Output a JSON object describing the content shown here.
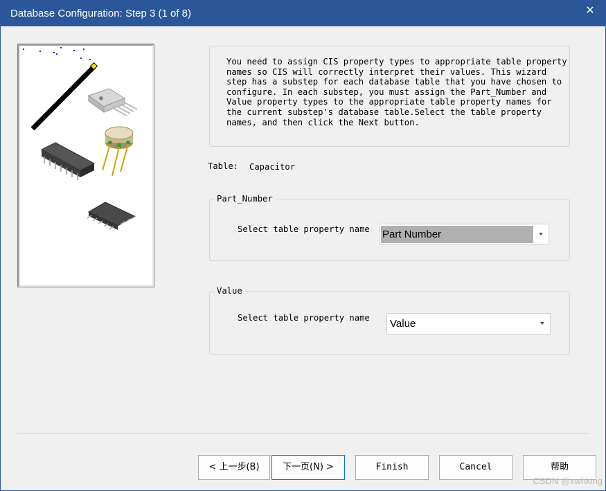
{
  "window": {
    "title": "Database Configuration: Step 3 (1 of 8)",
    "close_glyph": "✕"
  },
  "description": "You need to assign CIS property types to appropriate table property names so CIS will correctly interpret their values. This wizard step has a substep for each database table that you have chosen to configure. In each substep, you must assign the Part_Number and Value property types to the appropriate table property names for the current substep's database table.Select the table property names, and then click the Next button.",
  "table": {
    "label": "Table:",
    "value": "Capacitor"
  },
  "part_number_group": {
    "legend": "Part_Number",
    "select_label": "Select table property name",
    "selected_value": "Part Number"
  },
  "value_group": {
    "legend": "Value",
    "select_label": "Select table property name",
    "selected_value": "Value"
  },
  "buttons": {
    "back": "< 上一步(B)",
    "next": "下一页(N) >",
    "finish": "Finish",
    "cancel": "Cancel",
    "help": "帮助"
  },
  "watermark": "CSDN @xwhking",
  "colors": {
    "titlebar": "#2b579a",
    "selection_highlight": "#b0b0b0"
  },
  "icons": [
    "close-icon",
    "magic-wand-icon",
    "ic-chip-icon",
    "transistor-icon",
    "dip-chip-icon",
    "smd-chip-icon",
    "dropdown-arrow-icon"
  ]
}
